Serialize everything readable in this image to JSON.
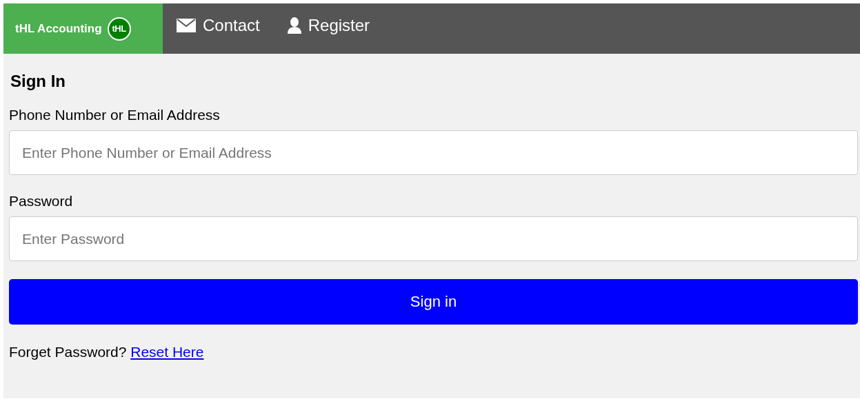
{
  "navbar": {
    "brand": "tHL Accounting",
    "logo_text": "tHL",
    "links": [
      {
        "kind": "mail",
        "label": "Contact"
      },
      {
        "kind": "user",
        "label": "Register"
      }
    ]
  },
  "form": {
    "title": "Sign In",
    "fields": [
      {
        "label": "Phone Number or Email Address",
        "placeholder": "Enter Phone Number or Email Address"
      },
      {
        "label": "Password",
        "placeholder": "Enter Password"
      }
    ],
    "submit": "Sign in",
    "footer_text": "Forget Password?",
    "footer_link": "Reset Here"
  }
}
